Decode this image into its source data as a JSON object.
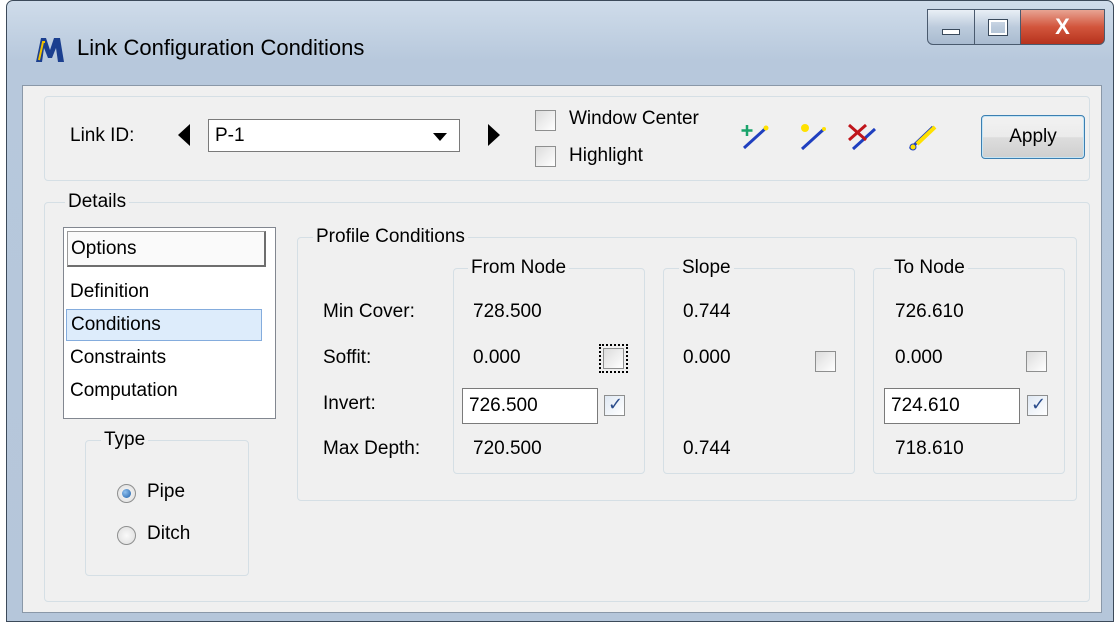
{
  "window": {
    "title": "Link Configuration Conditions",
    "close_glyph": "X"
  },
  "toolbar": {
    "link_id_label": "Link ID:",
    "link_id_value": "P-1",
    "window_center_label": "Window Center",
    "window_center_checked": false,
    "highlight_label": "Highlight",
    "highlight_checked": false,
    "apply_label": "Apply"
  },
  "details": {
    "label": "Details",
    "options_header": "Options",
    "items": [
      {
        "label": "Definition",
        "selected": false
      },
      {
        "label": "Conditions",
        "selected": true
      },
      {
        "label": "Constraints",
        "selected": false
      },
      {
        "label": "Computation",
        "selected": false
      }
    ]
  },
  "type": {
    "label": "Type",
    "options": [
      {
        "label": "Pipe",
        "checked": true
      },
      {
        "label": "Ditch",
        "checked": false
      }
    ]
  },
  "profile": {
    "label": "Profile Conditions",
    "rows": [
      "Min Cover:",
      "Soffit:",
      "Invert:",
      "Max Depth:"
    ],
    "from_node": {
      "label": "From Node",
      "min_cover": "728.500",
      "soffit": "0.000",
      "soffit_checked": false,
      "invert": "726.500",
      "invert_checked": true,
      "max_depth": "720.500"
    },
    "slope": {
      "label": "Slope",
      "min_cover": "0.744",
      "soffit": "0.000",
      "soffit_checked": false,
      "max_depth": "0.744"
    },
    "to_node": {
      "label": "To Node",
      "min_cover": "726.610",
      "soffit": "0.000",
      "soffit_checked": false,
      "invert": "724.610",
      "invert_checked": true,
      "max_depth": "718.610"
    }
  },
  "colors": {
    "titlebar": "#b7c8dc",
    "close_button": "#d2553c",
    "selection": "#ddecfb",
    "tool_blue": "#1f3fbf",
    "tool_yellow": "#ffe100",
    "tool_red": "#c0151b",
    "tool_green": "#1aa36b"
  },
  "icons": [
    "app-logo-icon",
    "add-link-icon",
    "select-link-icon",
    "delete-link-icon",
    "edit-link-icon"
  ]
}
